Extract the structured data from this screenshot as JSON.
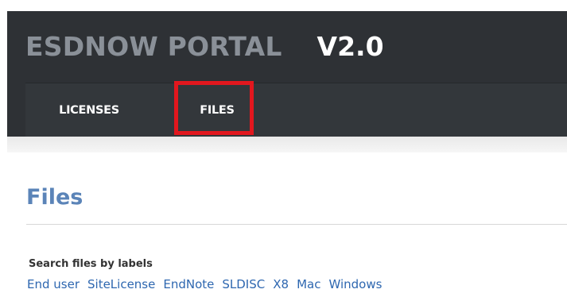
{
  "header": {
    "brand_name": "ESDNOW PORTAL",
    "version": "V2.0"
  },
  "nav": {
    "items": [
      {
        "label": "LICENSES"
      },
      {
        "label": "FILES",
        "highlighted": true
      }
    ]
  },
  "main": {
    "title": "Files",
    "search_label": "Search files by labels",
    "labels": [
      "End user",
      "SiteLicense",
      "EndNote",
      "SLDISC",
      "X8",
      "Mac",
      "Windows"
    ]
  },
  "colors": {
    "header_bg": "#2e3135",
    "brand_gray": "#8a9098",
    "title_blue": "#5b84b8",
    "link_blue": "#2e67b0",
    "highlight_red": "#e2171e"
  }
}
